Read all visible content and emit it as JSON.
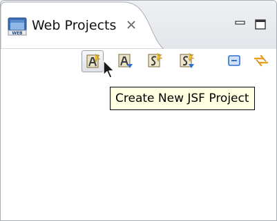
{
  "view": {
    "title": "Web Projects",
    "tab_icon": "web-projects-view-icon",
    "close_icon": "close-tab-icon",
    "controls": {
      "minimize_icon": "minimize-icon",
      "maximize_icon": "maximize-icon"
    }
  },
  "toolbar": {
    "items": [
      {
        "id": "new-jsf-project",
        "icon": "create-new-jsf-project-icon",
        "pressed": true
      },
      {
        "id": "new-project-2",
        "icon": "new-project-icon"
      },
      {
        "id": "new-project-3",
        "icon": "new-project-wizard-icon"
      },
      {
        "id": "new-project-4",
        "icon": "new-struts-project-icon"
      },
      {
        "id": "collapse-all",
        "icon": "collapse-all-icon"
      },
      {
        "id": "link-with-editor",
        "icon": "link-with-editor-icon"
      }
    ]
  },
  "tooltip": {
    "text": "Create New JSF Project"
  },
  "colors": {
    "tooltip_bg": "#ffffe1",
    "accent_blue": "#2d6fcf",
    "accent_orange": "#e8a21c"
  }
}
